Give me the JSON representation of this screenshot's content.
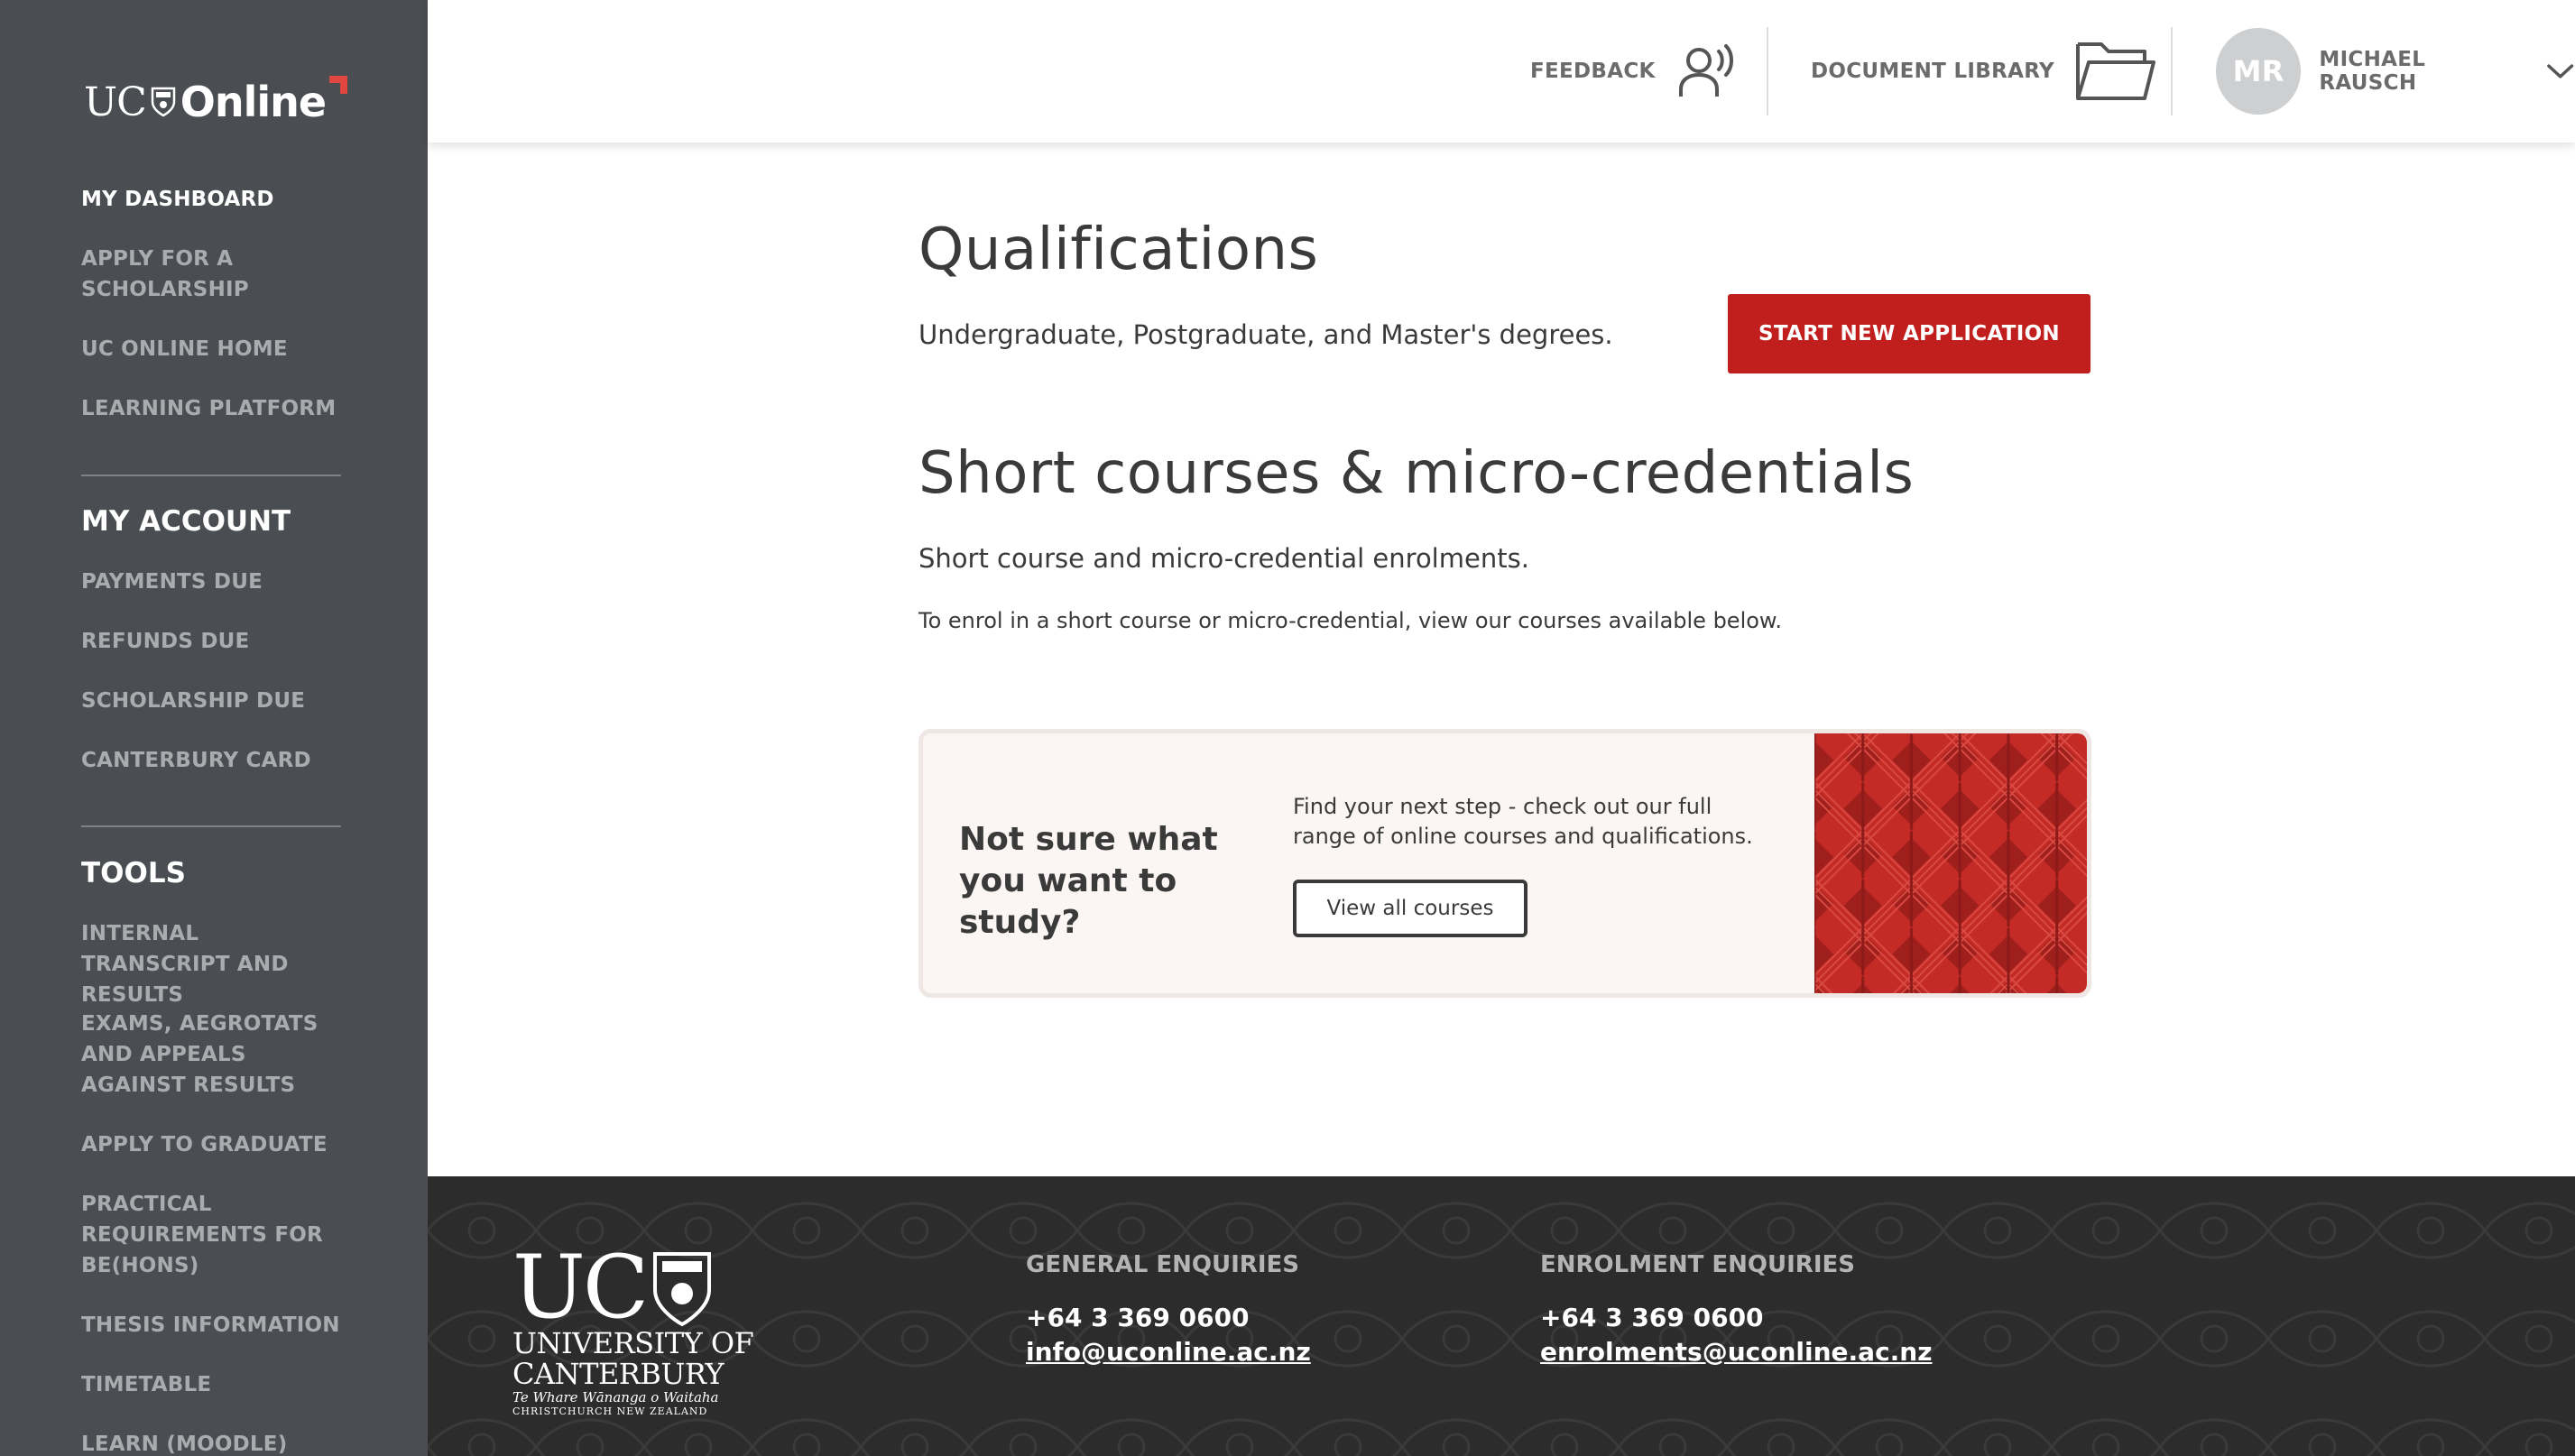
{
  "sidebar": {
    "logo": {
      "left": "UC",
      "right": "Online"
    },
    "nav_top": [
      {
        "label": "MY DASHBOARD",
        "active": true
      },
      {
        "label": "APPLY FOR A SCHOLARSHIP"
      },
      {
        "label": "UC ONLINE HOME"
      },
      {
        "label": "LEARNING PLATFORM"
      }
    ],
    "account_heading": "MY ACCOUNT",
    "account_items": [
      {
        "label": "PAYMENTS DUE"
      },
      {
        "label": "REFUNDS DUE"
      },
      {
        "label": "SCHOLARSHIP DUE"
      },
      {
        "label": "CANTERBURY CARD"
      }
    ],
    "tools_heading": "TOOLS",
    "tools_items": [
      {
        "label": "INTERNAL TRANSCRIPT AND RESULTS"
      },
      {
        "label": "EXAMS, AEGROTATS AND APPEALS AGAINST RESULTS"
      },
      {
        "label": "APPLY TO GRADUATE"
      },
      {
        "label": "PRACTICAL REQUIREMENTS FOR BE(HONS)"
      },
      {
        "label": "THESIS INFORMATION"
      },
      {
        "label": "TIMETABLE"
      },
      {
        "label": "LEARN (MOODLE)"
      }
    ]
  },
  "header": {
    "feedback_label": "FEEDBACK",
    "document_library_label": "DOCUMENT LIBRARY",
    "user_initials": "MR",
    "user_name": "MICHAEL RAUSCH"
  },
  "main": {
    "qualifications": {
      "title": "Qualifications",
      "description": "Undergraduate, Postgraduate, and Master's degrees.",
      "button_label": "START NEW APPLICATION"
    },
    "short_courses": {
      "title": "Short courses & micro-credentials",
      "description": "Short course and micro-credential enrolments.",
      "note": "To enrol in a short course or micro-credential, view our courses available below."
    },
    "promo": {
      "title": "Not sure what you want to study?",
      "text": "Find your next step - check out our full range of online courses and qualifications.",
      "button_label": "View all courses"
    }
  },
  "footer": {
    "logo": {
      "big": "UC",
      "line1": "UNIVERSITY OF",
      "line2": "CANTERBURY",
      "maori": "Te Whare Wānanga o Waitaha",
      "city": "CHRISTCHURCH NEW ZEALAND"
    },
    "general": {
      "heading": "GENERAL ENQUIRIES",
      "phone": "+64 3 369 0600",
      "email": "info@uconline.ac.nz"
    },
    "enrolment": {
      "heading": "ENROLMENT ENQUIRIES",
      "phone": "+64 3 369 0600",
      "email": "enrolments@uconline.ac.nz"
    }
  },
  "colors": {
    "sidebar_bg": "#4a4d51",
    "primary_red": "#c01f1d",
    "footer_bg": "#2c2c2c",
    "promo_bg": "#fbf6f4"
  }
}
